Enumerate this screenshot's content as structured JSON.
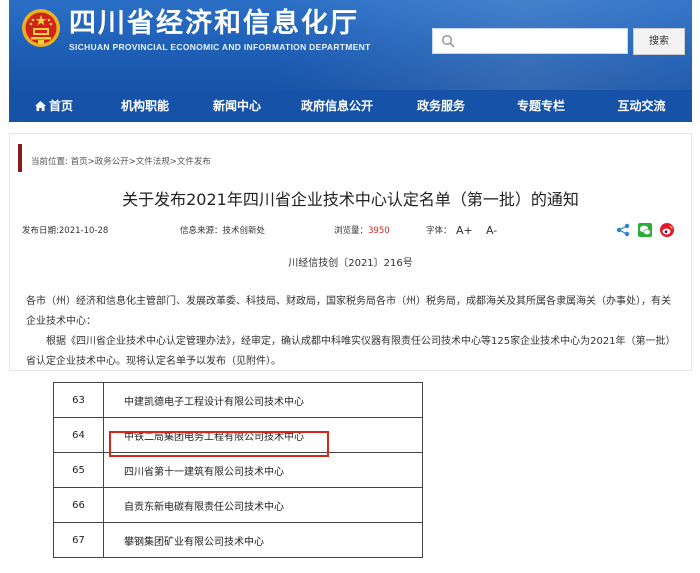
{
  "site": {
    "title": "四川省经济和信息化厅",
    "subtitle": "SICHUAN PROVINCIAL ECONOMIC AND INFORMATION DEPARTMENT",
    "search_placeholder": "",
    "search_button": "搜索"
  },
  "nav": [
    {
      "label": "首页",
      "icon": "home-icon"
    },
    {
      "label": "机构职能"
    },
    {
      "label": "新闻中心"
    },
    {
      "label": "政府信息公开"
    },
    {
      "label": "政务服务"
    },
    {
      "label": "专题专栏"
    },
    {
      "label": "互动交流"
    }
  ],
  "article": {
    "breadcrumb": "当前位置: 首页>政务公开>文件法规>文件发布",
    "title": "关于发布2021年四川省企业技术中心认定名单（第一批）的通知",
    "meta": {
      "date_label": "发布日期:",
      "date": "2021-10-28",
      "source_label": "信息来源：",
      "source": "技术创新处",
      "views_label": "浏览量：",
      "views": "3950",
      "font_label": "字体：",
      "font_increase": "A+",
      "font_decrease": "A-"
    },
    "doc_number": "川经信技创〔2021〕216号",
    "paragraphs": [
      "各市（州）经济和信息化主管部门、发展改革委、科技局、财政局，国家税务局各市（州）税务局，成都海关及其所属各隶属海关（办事处），有关企业技术中心：",
      "　　根据《四川省企业技术中心认定管理办法》，经审定，确认成都中科唯实仪器有限责任公司技术中心等125家企业技术中心为2021年（第一批）省认定企业技术中心。现将认定名单予以发布（见附件）。"
    ],
    "accent_color": "#8b1a1a",
    "views_color": "#d9261c"
  },
  "table": {
    "rows": [
      {
        "num": "63",
        "name": "中建凯德电子工程设计有限公司技术中心"
      },
      {
        "num": "64",
        "name": "中铁二局集团电务工程有限公司技术中心",
        "highlighted": true
      },
      {
        "num": "65",
        "name": "四川省第十一建筑有限公司技术中心"
      },
      {
        "num": "66",
        "name": "自贡东新电碳有限责任公司技术中心"
      },
      {
        "num": "67",
        "name": "攀钢集团矿业有限公司技术中心"
      }
    ],
    "highlight_color": "#d9261c"
  },
  "colors": {
    "header_blue": "#1e5fb6",
    "nav_blue": "#1552a8"
  }
}
